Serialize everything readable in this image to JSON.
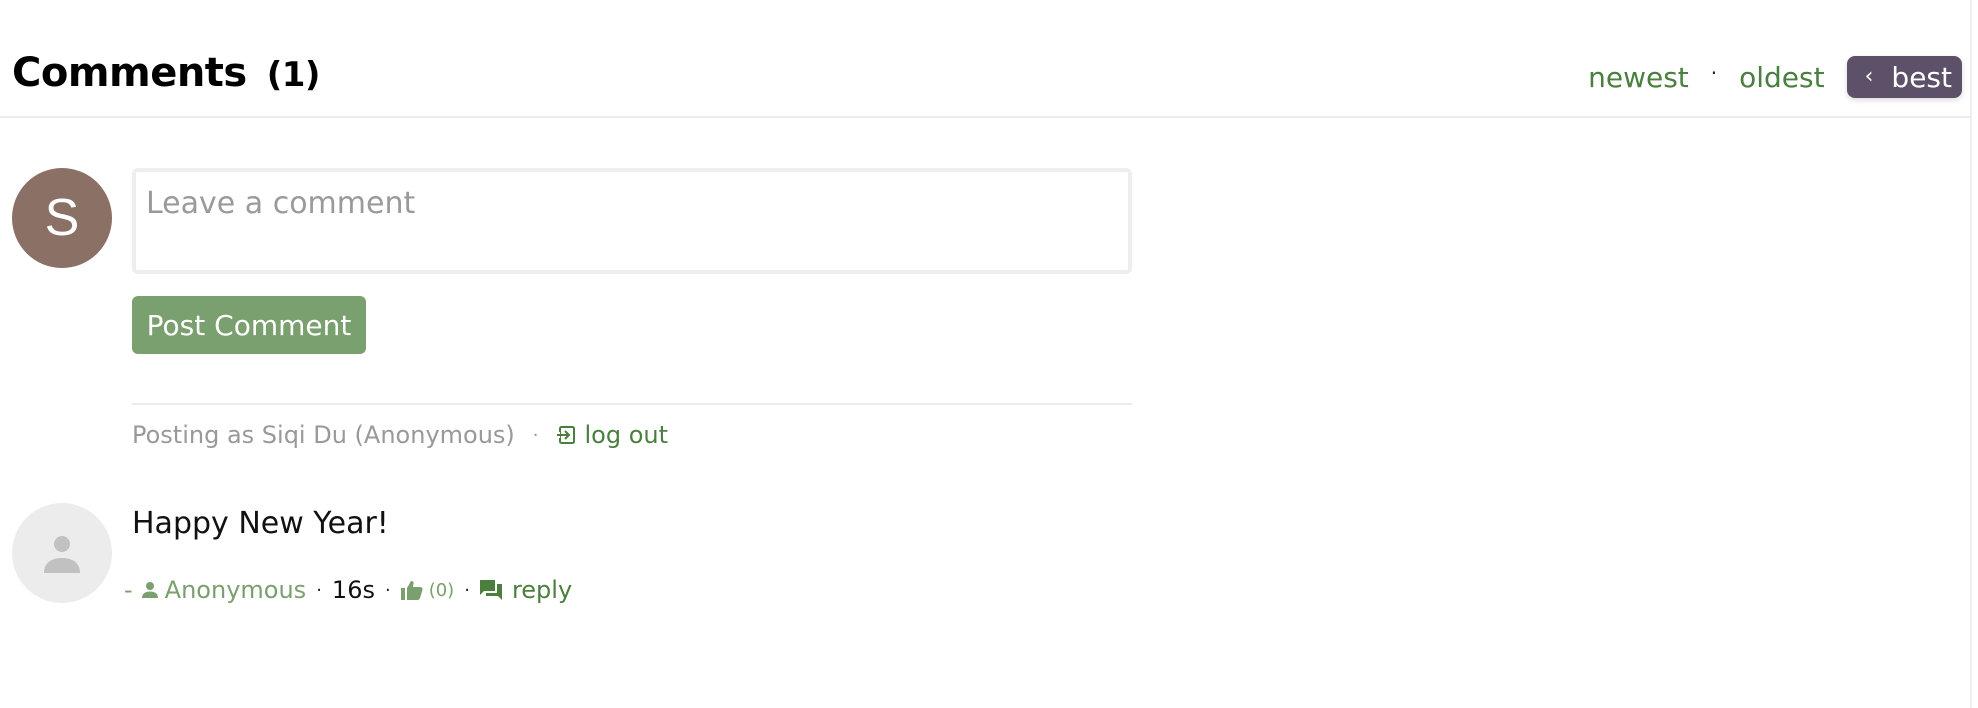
{
  "header": {
    "title": "Comments",
    "count": "(1)"
  },
  "sort": {
    "options": [
      "newest",
      "oldest",
      "best"
    ],
    "separator": "·",
    "active": "best",
    "active_icon": "chevron-left-icon"
  },
  "composer": {
    "avatar_initial": "S",
    "avatar_color": "#8a7065",
    "placeholder": "Leave a comment",
    "value": "",
    "post_label": "Post Comment",
    "post_color": "#79a06e",
    "posting_as": "Posting as Siqi Du (Anonymous)",
    "separator": "·",
    "logout_label": "log out",
    "logout_icon": "sign-out-icon"
  },
  "comments": [
    {
      "avatar_icon": "person-icon",
      "text": "Happy New Year!",
      "dash": "-",
      "author_icon": "person-icon",
      "author": "Anonymous",
      "time": "16s",
      "like_icon": "thumbs-up-icon",
      "likes": "(0)",
      "reply_icon": "chat-bubbles-icon",
      "reply_label": "reply",
      "separator": "·"
    }
  ],
  "colors": {
    "accent_green": "#4a7f3f",
    "light_green": "#79a06e",
    "active_tab": "#5c5168"
  }
}
